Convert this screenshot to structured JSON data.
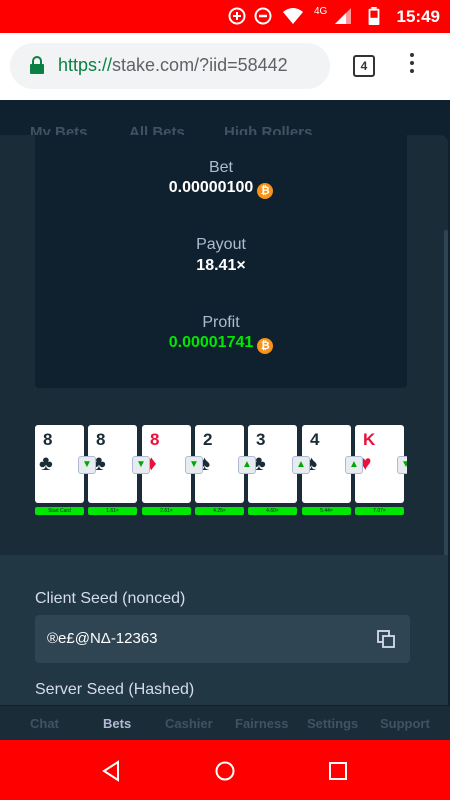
{
  "status_bar": {
    "time": "15:49",
    "network": "4G",
    "icons": [
      "add-circle-icon",
      "do-not-disturb-icon",
      "wifi-icon",
      "signal-icon",
      "battery-icon"
    ]
  },
  "browser": {
    "url_scheme": "https://",
    "url_rest": "stake.com/?iid=58442",
    "tab_count": "4"
  },
  "background_tabs": [
    "My Bets",
    "All Bets",
    "High Rollers"
  ],
  "bet_info": {
    "bet_label": "Bet",
    "bet_value": "0.00000100",
    "payout_label": "Payout",
    "payout_value": "18.41×",
    "profit_label": "Profit",
    "profit_value": "0.00001741",
    "currency_icon": "bitcoin-icon"
  },
  "cards": [
    {
      "rank": "8",
      "suit": "♣",
      "color": "black",
      "arrow": "",
      "multiplier": "Start Card"
    },
    {
      "rank": "8",
      "suit": "♣",
      "color": "black",
      "arrow": "▼",
      "multiplier": "1.61×"
    },
    {
      "rank": "8",
      "suit": "♦",
      "color": "red",
      "arrow": "▼",
      "multiplier": "2.61×"
    },
    {
      "rank": "2",
      "suit": "♠",
      "color": "black",
      "arrow": "▼",
      "multiplier": "4.25×"
    },
    {
      "rank": "3",
      "suit": "♣",
      "color": "black",
      "arrow": "▲",
      "multiplier": "4.60×"
    },
    {
      "rank": "4",
      "suit": "♠",
      "color": "black",
      "arrow": "▲",
      "multiplier": "5.44×"
    },
    {
      "rank": "K",
      "suit": "♥",
      "color": "red",
      "arrow": "▲",
      "multiplier": "7.07×"
    },
    {
      "rank": "",
      "suit": "",
      "color": "black",
      "arrow": "▼",
      "multiplier": ""
    }
  ],
  "seeds": {
    "client_seed_label": "Client Seed (nonced)",
    "client_seed_value": "®e£@NΔ-12363",
    "server_seed_label": "Server Seed (Hashed)"
  },
  "bottom_nav": [
    "Chat",
    "Bets",
    "Cashier",
    "Fairness",
    "Settings",
    "Support"
  ],
  "bottom_nav_active": "Bets",
  "colors": {
    "accent_green": "#00e701",
    "status_red": "#ff0000",
    "bg": "#0f212e",
    "bitcoin": "#f7931a"
  }
}
